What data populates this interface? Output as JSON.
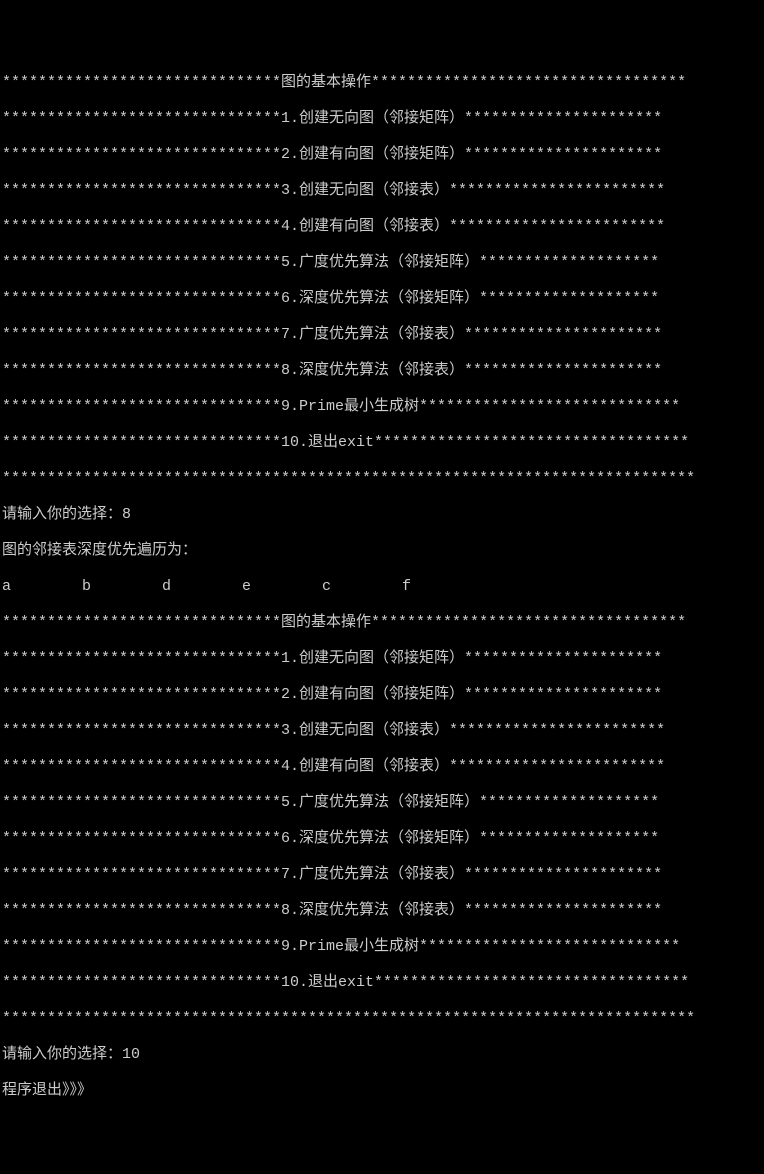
{
  "menu": {
    "title": "*******************************图的基本操作***********************************",
    "items": [
      "*******************************1.创建无向图（邻接矩阵）**********************",
      "*******************************2.创建有向图（邻接矩阵）**********************",
      "*******************************3.创建无向图（邻接表）************************",
      "*******************************4.创建有向图（邻接表）************************",
      "*******************************5.广度优先算法（邻接矩阵）********************",
      "*******************************6.深度优先算法（邻接矩阵）********************",
      "*******************************7.广度优先算法（邻接表）**********************",
      "*******************************8.深度优先算法（邻接表）**********************",
      "*******************************9.Prime最小生成树*****************************",
      "*******************************10.退出exit***********************************",
      "*****************************************************************************"
    ]
  },
  "prompts": {
    "input_label": "请输入你的选择：",
    "first_choice": "8",
    "traversal_label": "图的邻接表深度优先遍历为：",
    "second_choice": "10",
    "exit_msg": "程序退出》》》"
  },
  "traversal_result": [
    "a",
    "b",
    "d",
    "e",
    "c",
    "f"
  ]
}
